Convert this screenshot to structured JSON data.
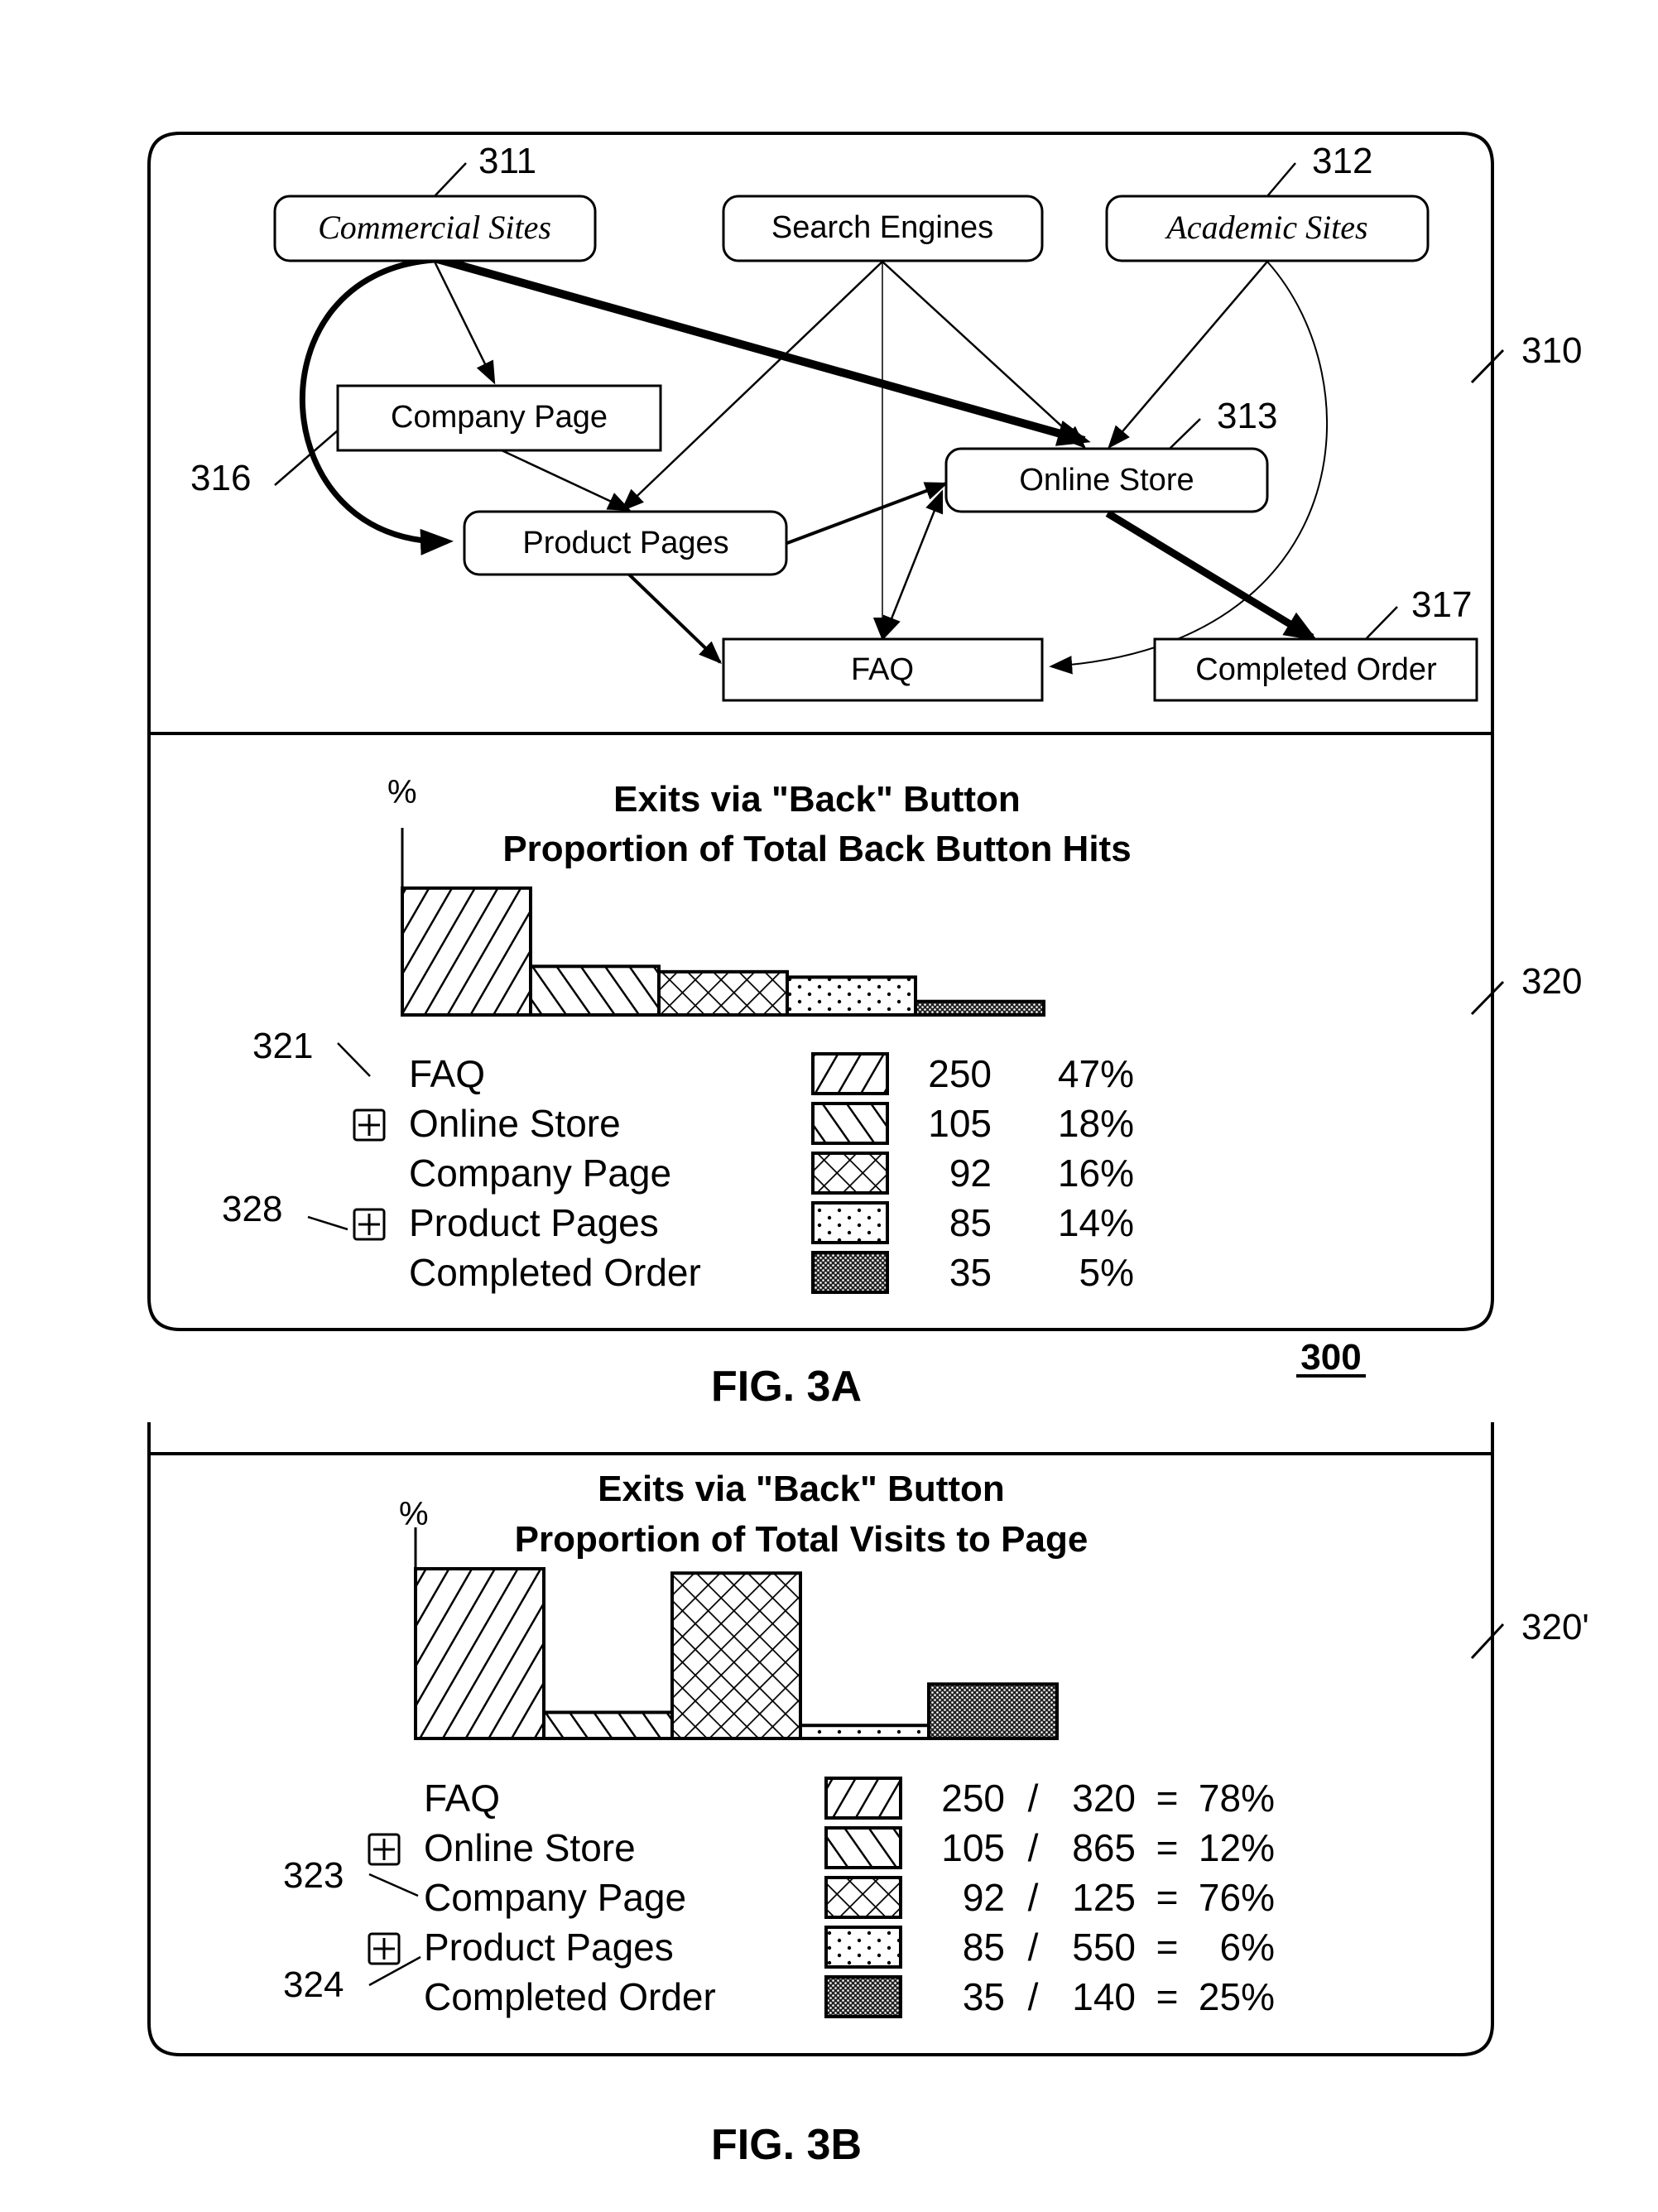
{
  "figure_ref": "300",
  "fig_a_label": "FIG. 3A",
  "fig_b_label": "FIG. 3B",
  "panels": {
    "flow_ref": "310",
    "chart_a_ref": "320",
    "chart_b_ref": "320'"
  },
  "flow_diagram": {
    "nodes": [
      {
        "id": "commercial",
        "label": "Commercial Sites",
        "ref": "311",
        "style": "rounded-italic"
      },
      {
        "id": "search",
        "label": "Search Engines",
        "ref": "",
        "style": "rounded"
      },
      {
        "id": "academic",
        "label": "Academic Sites",
        "ref": "312",
        "style": "rounded-italic"
      },
      {
        "id": "company",
        "label": "Company Page",
        "ref": "316",
        "style": "rect"
      },
      {
        "id": "online",
        "label": "Online Store",
        "ref": "313",
        "style": "rounded"
      },
      {
        "id": "product",
        "label": "Product Pages",
        "ref": "",
        "style": "rounded"
      },
      {
        "id": "faq",
        "label": "FAQ",
        "ref": "",
        "style": "rect"
      },
      {
        "id": "completed",
        "label": "Completed Order",
        "ref": "317",
        "style": "rect"
      }
    ],
    "edges": [
      {
        "from": "commercial",
        "to": "company",
        "weight": "thin"
      },
      {
        "from": "commercial",
        "to": "online",
        "weight": "heavy"
      },
      {
        "from": "commercial",
        "to": "product",
        "weight": "heavy",
        "curved": true
      },
      {
        "from": "search",
        "to": "product",
        "weight": "thin"
      },
      {
        "from": "search",
        "to": "online",
        "weight": "thin"
      },
      {
        "from": "search",
        "to": "faq",
        "weight": "hairline"
      },
      {
        "from": "academic",
        "to": "online",
        "weight": "thin"
      },
      {
        "from": "academic",
        "to": "faq",
        "weight": "hairline",
        "curved": true
      },
      {
        "from": "company",
        "to": "product",
        "weight": "thin"
      },
      {
        "from": "product",
        "to": "online",
        "weight": "medium"
      },
      {
        "from": "product",
        "to": "faq",
        "weight": "medium"
      },
      {
        "from": "online",
        "to": "faq",
        "weight": "thin",
        "bidirectional": true
      },
      {
        "from": "online",
        "to": "completed",
        "weight": "heavy"
      }
    ]
  },
  "chart_data": [
    {
      "type": "bar",
      "title": "Exits via \"Back\" Button",
      "subtitle": "Proportion of Total Back Button Hits",
      "ylabel": "%",
      "xlabel": "",
      "categories": [
        "FAQ",
        "Online Store",
        "Company Page",
        "Product Pages",
        "Completed Order"
      ],
      "values": [
        47,
        18,
        16,
        14,
        5
      ],
      "counts": [
        250,
        105,
        92,
        85,
        35
      ],
      "percent_labels": [
        "47%",
        "18%",
        "16%",
        "14%",
        "5%"
      ],
      "patterns": [
        "diag-up",
        "diag-down",
        "crosshatch",
        "dots",
        "dense"
      ],
      "expandable": [
        false,
        true,
        false,
        true,
        false
      ],
      "ylim": [
        0,
        50
      ],
      "legend_refs": {
        "321": "FAQ",
        "328": "Product Pages"
      },
      "grid": false
    },
    {
      "type": "bar",
      "title": "Exits via \"Back\" Button",
      "subtitle": "Proportion of Total Visits to Page",
      "ylabel": "%",
      "xlabel": "",
      "categories": [
        "FAQ",
        "Online Store",
        "Company Page",
        "Product Pages",
        "Completed Order"
      ],
      "values": [
        78,
        12,
        76,
        6,
        25
      ],
      "numerators": [
        250,
        105,
        92,
        85,
        35
      ],
      "denominators": [
        320,
        865,
        125,
        550,
        140
      ],
      "percent_labels": [
        "78%",
        "12%",
        "76%",
        "6%",
        "25%"
      ],
      "patterns": [
        "diag-up",
        "diag-down",
        "crosshatch",
        "dots",
        "dense"
      ],
      "expandable": [
        false,
        true,
        false,
        true,
        false
      ],
      "ylim": [
        0,
        78
      ],
      "legend_refs": {
        "323": "Company Page",
        "324": "Product Pages"
      },
      "grid": false
    }
  ]
}
